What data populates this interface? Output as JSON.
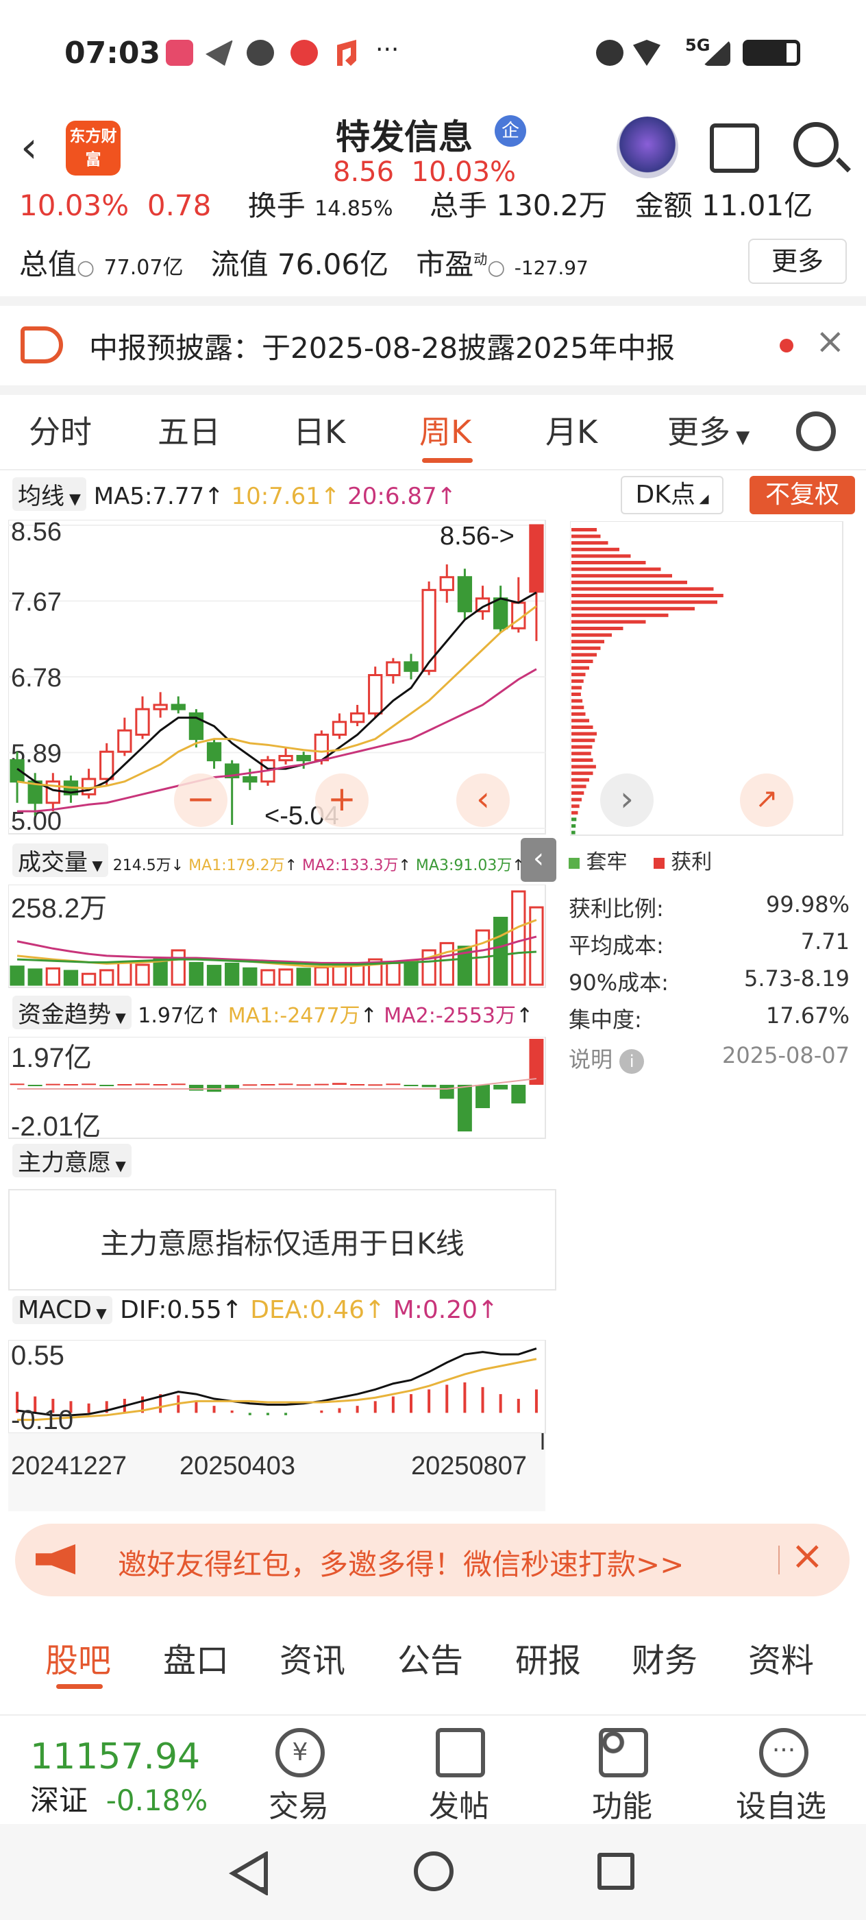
{
  "status_bar": {
    "time": "07:03",
    "network": "5G"
  },
  "header": {
    "stock_name": "特发信息",
    "badge": "企",
    "price": "8.56",
    "change_pct": "10.03%",
    "logo_text": "东方财富"
  },
  "quote": {
    "row1": {
      "change_pct": "10.03%",
      "change": "0.78",
      "turnover_label": "换手",
      "turnover": "14.85%",
      "volume_label": "总手",
      "volume": "130.2万",
      "amount_label": "金额",
      "amount": "11.01亿"
    },
    "row2": {
      "mcap_label": "总值",
      "mcap": "77.07亿",
      "float_label": "流值",
      "float": "76.06亿",
      "pe_label": "市盈",
      "pe_sup": "动",
      "pe": "-127.97",
      "more": "更多"
    }
  },
  "notice": {
    "text": "中报预披露：于2025-08-28披露2025年中报"
  },
  "period_tabs": [
    "分时",
    "五日",
    "日K",
    "周K",
    "月K",
    "更多"
  ],
  "active_tab": 3,
  "chart_header": {
    "ma_select": "均线",
    "ma5": "MA5:7.77",
    "ma10": "10:7.61",
    "ma20": "20:6.87",
    "dk": "DK点",
    "adjust": "不复权"
  },
  "chart_data": [
    {
      "type": "candlestick",
      "title": "周K",
      "y_ticks": [
        "8.56",
        "7.67",
        "6.78",
        "5.89",
        "5.00"
      ],
      "ylim": [
        5.0,
        8.56
      ],
      "annotations": [
        "8.56->",
        "<-5.04"
      ],
      "candles": [
        {
          "o": 5.8,
          "c": 5.55,
          "h": 5.9,
          "l": 5.3
        },
        {
          "o": 5.55,
          "c": 5.3,
          "h": 5.65,
          "l": 5.15
        },
        {
          "o": 5.3,
          "c": 5.55,
          "h": 5.65,
          "l": 5.2
        },
        {
          "o": 5.55,
          "c": 5.4,
          "h": 5.62,
          "l": 5.3
        },
        {
          "o": 5.4,
          "c": 5.58,
          "h": 5.7,
          "l": 5.35
        },
        {
          "o": 5.58,
          "c": 5.9,
          "h": 6.0,
          "l": 5.5
        },
        {
          "o": 5.9,
          "c": 6.15,
          "h": 6.3,
          "l": 5.85
        },
        {
          "o": 6.1,
          "c": 6.4,
          "h": 6.55,
          "l": 6.05
        },
        {
          "o": 6.4,
          "c": 6.45,
          "h": 6.6,
          "l": 6.3
        },
        {
          "o": 6.45,
          "c": 6.4,
          "h": 6.55,
          "l": 6.35
        },
        {
          "o": 6.35,
          "c": 6.05,
          "h": 6.4,
          "l": 5.95
        },
        {
          "o": 6.0,
          "c": 5.8,
          "h": 6.05,
          "l": 5.7
        },
        {
          "o": 5.75,
          "c": 5.6,
          "h": 5.8,
          "l": 5.04
        },
        {
          "o": 5.6,
          "c": 5.55,
          "h": 5.7,
          "l": 5.45
        },
        {
          "o": 5.55,
          "c": 5.8,
          "h": 5.85,
          "l": 5.5
        },
        {
          "o": 5.8,
          "c": 5.85,
          "h": 5.95,
          "l": 5.75
        },
        {
          "o": 5.85,
          "c": 5.8,
          "h": 5.9,
          "l": 5.7
        },
        {
          "o": 5.8,
          "c": 6.1,
          "h": 6.15,
          "l": 5.75
        },
        {
          "o": 6.1,
          "c": 6.25,
          "h": 6.35,
          "l": 6.05
        },
        {
          "o": 6.25,
          "c": 6.35,
          "h": 6.45,
          "l": 6.2
        },
        {
          "o": 6.35,
          "c": 6.8,
          "h": 6.9,
          "l": 6.3
        },
        {
          "o": 6.8,
          "c": 6.95,
          "h": 7.0,
          "l": 6.7
        },
        {
          "o": 6.95,
          "c": 6.85,
          "h": 7.05,
          "l": 6.75
        },
        {
          "o": 6.85,
          "c": 7.8,
          "h": 7.9,
          "l": 6.8
        },
        {
          "o": 7.8,
          "c": 7.95,
          "h": 8.1,
          "l": 7.65
        },
        {
          "o": 7.95,
          "c": 7.55,
          "h": 8.05,
          "l": 7.45
        },
        {
          "o": 7.55,
          "c": 7.7,
          "h": 7.85,
          "l": 7.45
        },
        {
          "o": 7.7,
          "c": 7.35,
          "h": 7.85,
          "l": 7.3
        },
        {
          "o": 7.35,
          "c": 7.65,
          "h": 7.95,
          "l": 7.3
        },
        {
          "o": 7.78,
          "c": 8.56,
          "h": 8.56,
          "l": 7.2
        }
      ],
      "ma5": [
        5.7,
        5.55,
        5.45,
        5.42,
        5.45,
        5.55,
        5.75,
        5.95,
        6.15,
        6.3,
        6.3,
        6.2,
        6.0,
        5.85,
        5.7,
        5.7,
        5.75,
        5.8,
        5.95,
        6.1,
        6.3,
        6.5,
        6.65,
        6.95,
        7.2,
        7.45,
        7.6,
        7.7,
        7.65,
        7.77
      ],
      "ma10": [
        5.55,
        5.52,
        5.5,
        5.48,
        5.47,
        5.5,
        5.55,
        5.65,
        5.75,
        5.9,
        6.0,
        6.05,
        6.05,
        6.0,
        5.98,
        5.95,
        5.92,
        5.9,
        5.92,
        5.98,
        6.05,
        6.2,
        6.35,
        6.5,
        6.7,
        6.9,
        7.1,
        7.3,
        7.45,
        7.61
      ],
      "ma20": [
        5.2,
        5.2,
        5.22,
        5.25,
        5.28,
        5.3,
        5.35,
        5.4,
        5.45,
        5.5,
        5.55,
        5.6,
        5.62,
        5.65,
        5.68,
        5.72,
        5.75,
        5.8,
        5.85,
        5.9,
        5.95,
        6.0,
        6.05,
        6.15,
        6.25,
        6.35,
        6.45,
        6.6,
        6.75,
        6.87
      ]
    },
    {
      "type": "bar",
      "title": "成交量",
      "y_top": "258.2万",
      "legend": [
        "214.5万",
        "MA1:179.2万",
        "MA2:133.3万",
        "MA3:91.03万"
      ],
      "values": [
        50,
        42,
        45,
        38,
        30,
        40,
        62,
        55,
        70,
        95,
        60,
        52,
        58,
        45,
        40,
        42,
        44,
        48,
        52,
        55,
        70,
        60,
        65,
        95,
        115,
        105,
        150,
        185,
        258,
        214
      ],
      "up": [
        false,
        false,
        true,
        false,
        true,
        true,
        true,
        true,
        false,
        true,
        false,
        false,
        false,
        false,
        true,
        true,
        false,
        true,
        true,
        true,
        true,
        true,
        false,
        true,
        true,
        false,
        true,
        false,
        true,
        true
      ]
    },
    {
      "type": "bar",
      "title": "资金趋势",
      "y_top": "1.97亿",
      "y_bottom": "-2.01亿",
      "legend": [
        "1.97亿",
        "MA1:-2477万",
        "MA2:-2553万"
      ],
      "values": [
        0.05,
        -0.05,
        0.04,
        0.03,
        0.05,
        -0.03,
        0.03,
        0.05,
        0.03,
        0.05,
        -0.25,
        -0.3,
        -0.15,
        0.02,
        0.03,
        0.05,
        0.02,
        0.04,
        0.08,
        0.03,
        0.02,
        0.05,
        -0.05,
        -0.1,
        -0.6,
        -2.0,
        -1.0,
        -0.2,
        -0.8,
        1.97
      ]
    },
    {
      "type": "bar",
      "title": "MACD",
      "y_top": "0.55",
      "y_bottom": "-0.10",
      "legend": [
        "DIF:0.55",
        "DEA:0.46",
        "M:0.20"
      ],
      "x_ticks": [
        "20241227",
        "20250403",
        "20250807"
      ],
      "values": [
        0.18,
        0.14,
        0.12,
        0.1,
        0.08,
        0.1,
        0.12,
        0.14,
        0.16,
        0.15,
        0.1,
        0.06,
        0.02,
        -0.02,
        -0.02,
        -0.02,
        0.0,
        0.02,
        0.04,
        0.06,
        0.1,
        0.14,
        0.16,
        0.2,
        0.24,
        0.26,
        0.22,
        0.16,
        0.12,
        0.2
      ],
      "dif": [
        0.02,
        0.0,
        -0.02,
        -0.02,
        -0.01,
        0.02,
        0.06,
        0.1,
        0.14,
        0.18,
        0.16,
        0.12,
        0.1,
        0.08,
        0.07,
        0.07,
        0.08,
        0.1,
        0.13,
        0.16,
        0.2,
        0.25,
        0.28,
        0.35,
        0.43,
        0.5,
        0.52,
        0.5,
        0.5,
        0.55
      ],
      "dea": [
        -0.06,
        -0.06,
        -0.05,
        -0.04,
        -0.03,
        -0.02,
        0.0,
        0.02,
        0.05,
        0.08,
        0.1,
        0.1,
        0.1,
        0.1,
        0.09,
        0.09,
        0.09,
        0.09,
        0.1,
        0.11,
        0.13,
        0.16,
        0.19,
        0.23,
        0.28,
        0.33,
        0.37,
        0.4,
        0.43,
        0.46
      ]
    }
  ],
  "volume_select": "成交量",
  "fund_select": "资金趋势",
  "intent": {
    "select": "主力意愿",
    "message": "主力意愿指标仅适用于日K线"
  },
  "macd_select": "MACD",
  "cost_panel": {
    "legend": [
      "套牢",
      "获利"
    ],
    "rows": [
      {
        "label": "获利比例:",
        "value": "99.98%"
      },
      {
        "label": "平均成本:",
        "value": "7.71"
      },
      {
        "label": "90%成本:",
        "value": "5.73-8.19"
      },
      {
        "label": "集中度:",
        "value": "17.67%"
      }
    ],
    "note_label": "说明",
    "date": "2025-08-07"
  },
  "promo": {
    "text": "邀好友得红包，多邀多得！微信秒速打款>>"
  },
  "bottom_tabs": [
    "股吧",
    "盘口",
    "资讯",
    "公告",
    "研报",
    "财务",
    "资料"
  ],
  "bottom_bar": {
    "index_value": "11157.94",
    "index_name": "深证",
    "index_change": "-0.18%",
    "items": [
      "交易",
      "发帖",
      "功能",
      "设自选"
    ]
  }
}
